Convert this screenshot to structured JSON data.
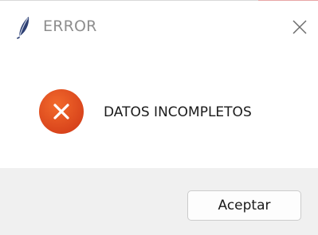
{
  "window": {
    "title": "ERROR",
    "app_icon": "feather-icon",
    "close_icon": "close-icon"
  },
  "message": {
    "icon": "error-icon",
    "icon_color": "#e04a16",
    "text": "DATOS INCOMPLETOS"
  },
  "buttons": {
    "accept_label": "Aceptar"
  }
}
